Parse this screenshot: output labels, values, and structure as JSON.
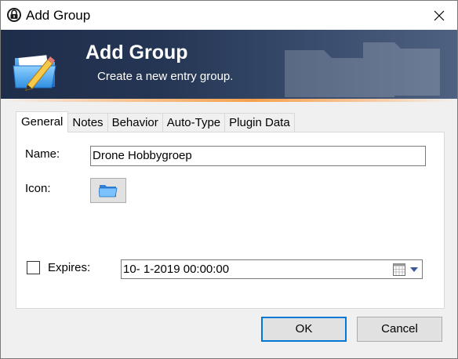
{
  "window": {
    "title": "Add Group"
  },
  "banner": {
    "title": "Add Group",
    "subtitle": "Create a new entry group."
  },
  "tabs": [
    {
      "label": "General",
      "active": true
    },
    {
      "label": "Notes",
      "active": false
    },
    {
      "label": "Behavior",
      "active": false
    },
    {
      "label": "Auto-Type",
      "active": false
    },
    {
      "label": "Plugin Data",
      "active": false
    }
  ],
  "general": {
    "name_label": "Name:",
    "name_value": "Drone Hobbygroep",
    "icon_label": "Icon:",
    "icon_name": "folder-icon",
    "expires_label": "Expires:",
    "expires_checked": false,
    "expires_value": "10-  1-2019 00:00:00"
  },
  "buttons": {
    "ok": "OK",
    "cancel": "Cancel"
  },
  "colors": {
    "banner_dark": "#1e2d4a",
    "accent_orange": "#f5a04c",
    "default_button_border": "#0078d7"
  }
}
